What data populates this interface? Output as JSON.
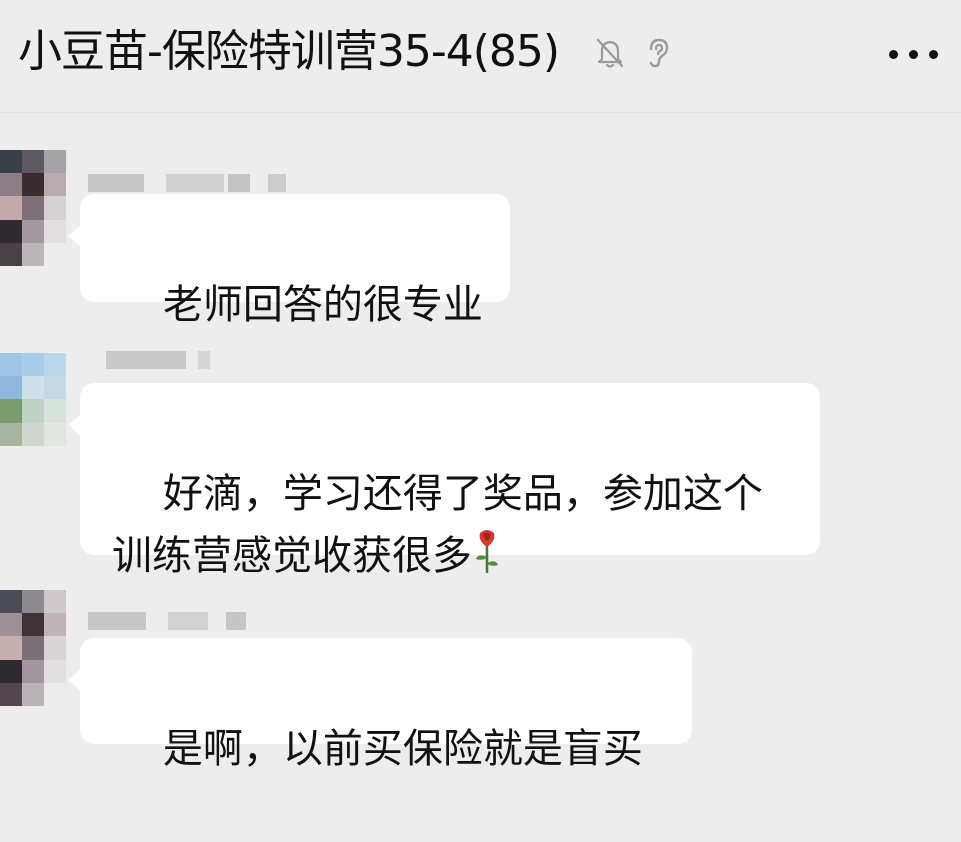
{
  "chat": {
    "title": "小豆苗-保险特训营35-4(85)",
    "icons": [
      "mute-bell-icon",
      "ear-icon",
      "more-icon"
    ]
  },
  "messages": [
    {
      "text": "老师回答的很专业",
      "emoji": ""
    },
    {
      "text_line1": "好滴，学习还得了奖品，参加这个",
      "text_line2": "训练营感觉收获很多",
      "emoji": "rose-icon"
    },
    {
      "text": "是啊，以前买保险就是盲买",
      "emoji": ""
    }
  ],
  "colors": {
    "background": "#ededed",
    "bubble": "#ffffff",
    "text": "#111111"
  }
}
